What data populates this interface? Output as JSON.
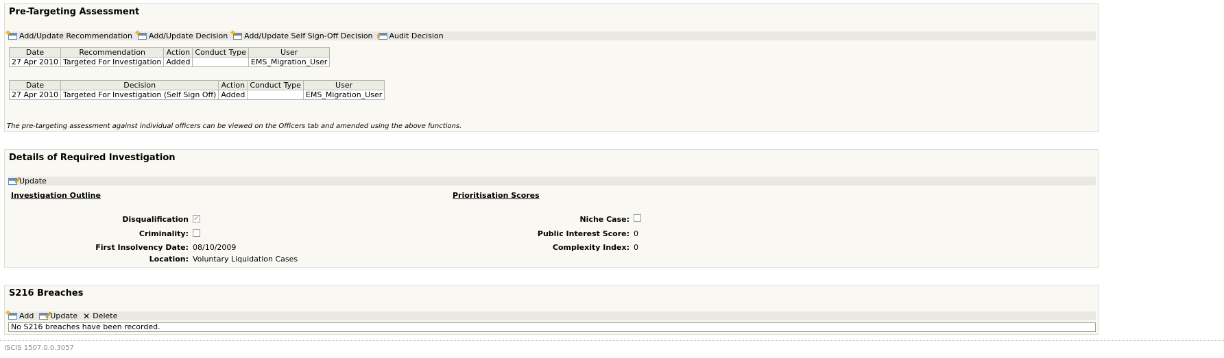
{
  "pre_targeting": {
    "title": "Pre-Targeting Assessment",
    "toolbar": [
      {
        "label": "Add/Update Recommendation",
        "icon": "add-recommendation-icon"
      },
      {
        "label": "Add/Update Decision",
        "icon": "add-decision-icon"
      },
      {
        "label": "Add/Update Self Sign-Off Decision",
        "icon": "self-sign-off-icon"
      },
      {
        "label": "Audit Decision",
        "icon": "audit-icon"
      }
    ],
    "recommendations": {
      "headers": [
        "Date",
        "Recommendation",
        "Action",
        "Conduct Type",
        "User"
      ],
      "rows": [
        [
          "27 Apr 2010",
          "Targeted For Investigation",
          "Added",
          "",
          "EMS_Migration_User"
        ]
      ]
    },
    "decisions": {
      "headers": [
        "Date",
        "Decision",
        "Action",
        "Conduct Type",
        "User"
      ],
      "rows": [
        [
          "27 Apr 2010",
          "Targeted For Investigation (Self Sign Off)",
          "Added",
          "",
          "EMS_Migration_User"
        ]
      ]
    },
    "note": "The pre-targeting assessment against individual officers can be viewed on the Officers tab and amended using the above functions."
  },
  "investigation": {
    "title": "Details of Required Investigation",
    "toolbar_update": "Update",
    "outline_heading": "Investigation Outline",
    "scores_heading": "Prioritisation Scores",
    "disqualification_label": "Disqualification",
    "disqualification_checked": true,
    "criminality_label": "Criminality:",
    "criminality_checked": false,
    "first_insolvency_label": "First Insolvency Date:",
    "first_insolvency_value": "08/10/2009",
    "location_label": "Location:",
    "location_value": "Voluntary Liquidation Cases",
    "niche_label": "Niche Case:",
    "niche_checked": false,
    "public_interest_label": "Public Interest Score:",
    "public_interest_value": "0",
    "complexity_label": "Complexity Index:",
    "complexity_value": "0"
  },
  "breaches": {
    "title": "S216 Breaches",
    "add_label": "Add",
    "update_label": "Update",
    "delete_label": "Delete",
    "empty_message": "No S216 breaches have been recorded."
  },
  "footer": {
    "version": "ISCIS 1507.0.0.3057"
  }
}
